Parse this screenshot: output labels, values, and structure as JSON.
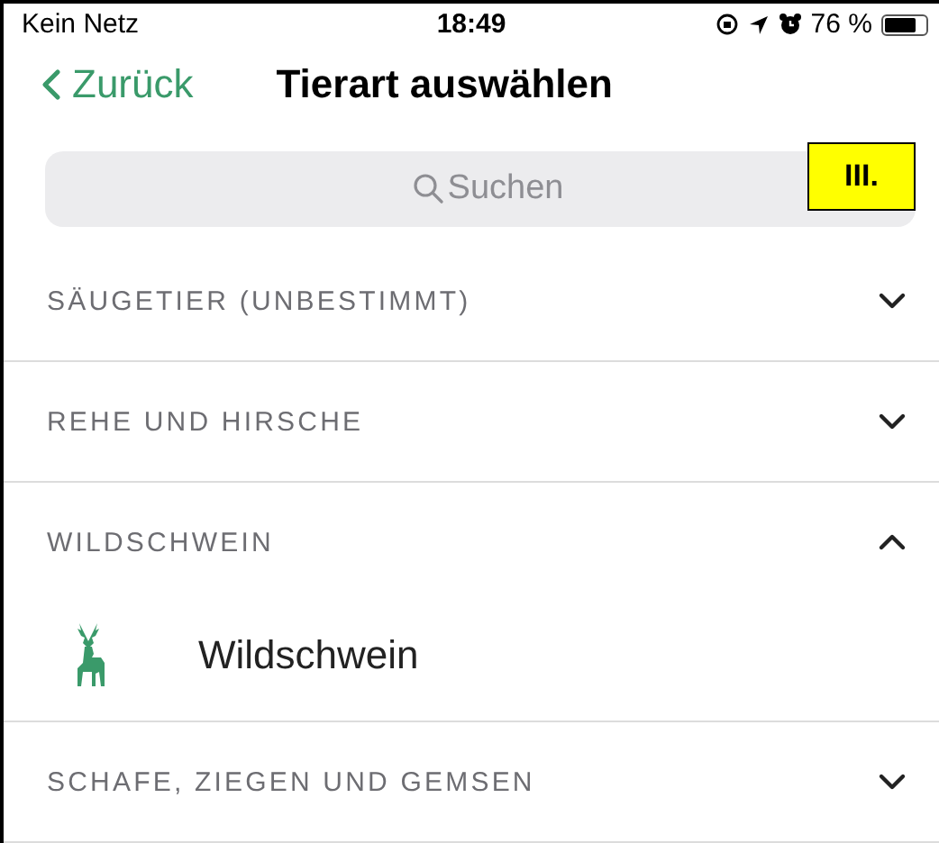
{
  "status_bar": {
    "carrier": "Kein Netz",
    "time": "18:49",
    "battery": "76 %"
  },
  "nav": {
    "back": "Zurück",
    "title": "Tierart auswählen"
  },
  "search": {
    "placeholder": "Suchen"
  },
  "annotation": "III.",
  "sections": [
    {
      "title": "SÄUGETIER (UNBESTIMMT)",
      "expanded": false
    },
    {
      "title": "REHE UND HIRSCHE",
      "expanded": false
    },
    {
      "title": "WILDSCHWEIN",
      "expanded": true,
      "items": [
        {
          "label": "Wildschwein"
        }
      ]
    },
    {
      "title": "SCHAFE, ZIEGEN UND GEMSEN",
      "expanded": false
    }
  ]
}
